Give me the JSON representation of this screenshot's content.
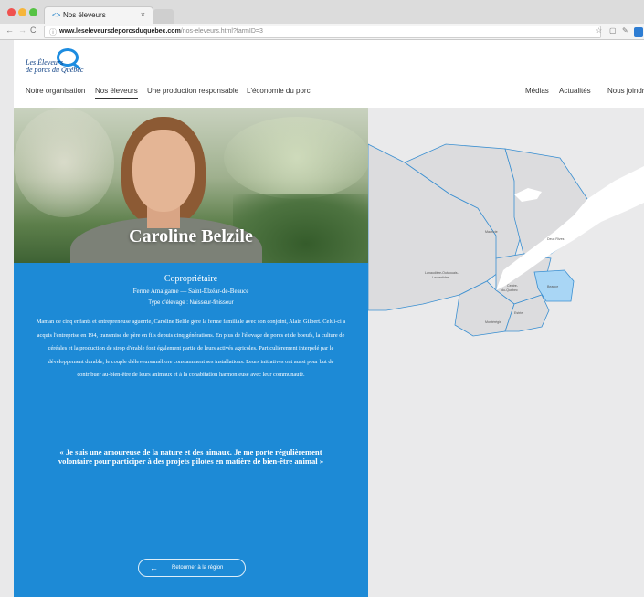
{
  "browser": {
    "tab_title": "Nos éleveurs",
    "tab_favicon": "<>",
    "tab_close": "×",
    "url_domain": "www.leseleveursdeporcsduquebec.com",
    "url_path": "/nos-eleveurs.html?farmID=3"
  },
  "header": {
    "logo_line1": "Les Éleveurs",
    "logo_line2": "de porcs du Québec",
    "nav_left": [
      "Notre organisation",
      "Nos éleveurs",
      "Une production responsable",
      "L'économie du porc"
    ],
    "nav_right": [
      "Médias",
      "Actualités",
      "Nous joindre"
    ],
    "active_nav": "Nos éleveurs"
  },
  "profile": {
    "name": "Caroline Belzile",
    "role": "Copropriétaire",
    "farm": "Ferme Amalgame — Saint-Élzéar-de-Beauce",
    "type": "Type d'élevage : Naisseur-finisseur",
    "description": "Maman de cinq enfants et entrepreneuse aguerrie, Caroline Belile gère la ferme familiale avec son conjoint, Alain Gilbert. Celui-ci a acquis l'entreprise en 194, transmise de père en fils depuis cinq générations. En plus de l'élevage de porcs et de boeufs, la culture de céréales et la production de sirop d'érable font également partie de leurs activés agricoles. Particulièrement interpelé par le développement durable, le couple d'éleveursaméliore constamment ses installations. Leurs initiatives ont aussi pour but de contribuer au-bien-être de leurs animaux et à la cohabitation harmonieuse avec leur communauté.",
    "quote": "« Je suis une amoureuse de la nature et des aimaux. Je me porte régulièrement volontaire pour participer à des projets pilotes en matière de bien-être animal »",
    "back_label": "Retourner à la région",
    "back_arrow": "←"
  },
  "map": {
    "regions": [
      "Mauricie",
      "Deux Rives",
      "Lanaudière-Outaouais-Laurentides",
      "Centre-du-Québec",
      "Beauce",
      "Montérégie",
      "Estrie"
    ],
    "highlighted_region": "Beauce",
    "colors": {
      "highlight": "#a9d6f5",
      "borders": "#3a8fd1",
      "river": "#ffffff",
      "land": "#dcdcde"
    }
  }
}
